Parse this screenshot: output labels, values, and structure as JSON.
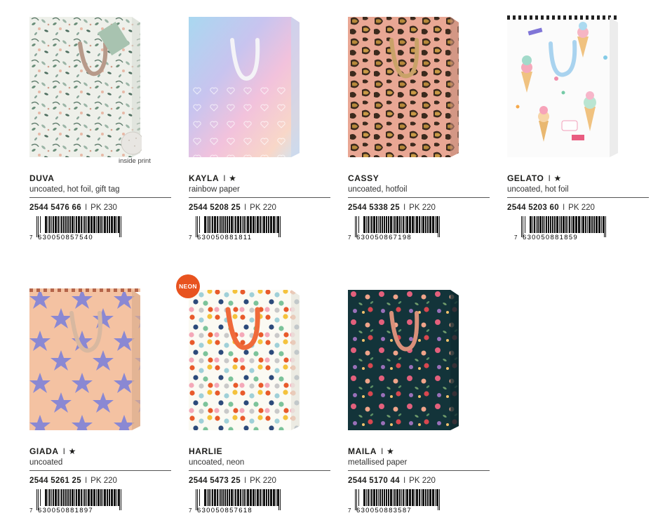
{
  "products": [
    {
      "name": "DUVA",
      "star": "",
      "desc": "uncoated, hot foil, gift tag",
      "code": "2544 5476 66",
      "pk": "PK 230",
      "ean_first": "7",
      "ean_rest": "630050857540",
      "extra": "inside print"
    },
    {
      "name": "KAYLA",
      "star": "★",
      "desc": "rainbow paper",
      "code": "2544 5208 25",
      "pk": "PK 220",
      "ean_first": "7",
      "ean_rest": "630050881811"
    },
    {
      "name": "CASSY",
      "star": "",
      "desc": "uncoated, hotfoil",
      "code": "2544 5338 25",
      "pk": "PK 220",
      "ean_first": "7",
      "ean_rest": "630050867198"
    },
    {
      "name": "GELATO",
      "star": "★",
      "desc": "uncoated, hot foil",
      "code": "2544 5203 60",
      "pk": "PK 220",
      "ean_first": "7",
      "ean_rest": "630050881859"
    },
    {
      "name": "GIADA",
      "star": "★",
      "desc": "uncoated",
      "code": "2544 5261 25",
      "pk": "PK 220",
      "ean_first": "7",
      "ean_rest": "630050881897"
    },
    {
      "name": "HARLIE",
      "star": "",
      "desc": "uncoated, neon",
      "code": "2544 5473 25",
      "pk": "PK 220",
      "ean_first": "7",
      "ean_rest": "630050857618",
      "badge": "NEON"
    },
    {
      "name": "MAILA",
      "star": "★",
      "desc": "metallised paper",
      "code": "2544 5170 44",
      "pk": "PK 220",
      "ean_first": "7",
      "ean_rest": "630050883587"
    }
  ],
  "separator": "I",
  "colors": {
    "text": "#1d1d1b",
    "neon_badge": "#e8531f"
  }
}
